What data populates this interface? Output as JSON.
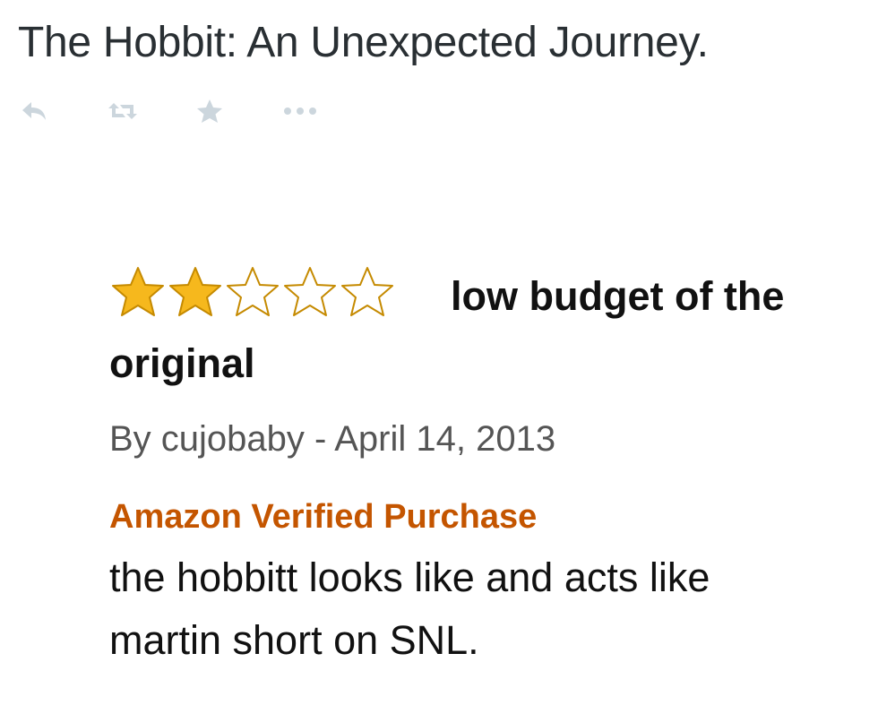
{
  "tweet": {
    "text": "The Hobbit: An Unexpected Journey.",
    "actions": [
      {
        "name": "reply",
        "icon": "reply-icon"
      },
      {
        "name": "retweet",
        "icon": "retweet-icon"
      },
      {
        "name": "favorite",
        "icon": "star-icon"
      },
      {
        "name": "more",
        "icon": "more-icon"
      }
    ],
    "action_color": "#ccd6dd"
  },
  "review": {
    "rating": 2,
    "rating_max": 5,
    "title_line1": "low budget of the",
    "title_line2": "original",
    "byline": "By cujobaby - April 14, 2013",
    "verified_label": "Amazon Verified Purchase",
    "body_line1": "the hobbitt looks like and acts like",
    "body_line2": "martin short on SNL.",
    "colors": {
      "star_filled": "#f6b81d",
      "star_outline": "#c58a00",
      "verified": "#c45500"
    }
  }
}
